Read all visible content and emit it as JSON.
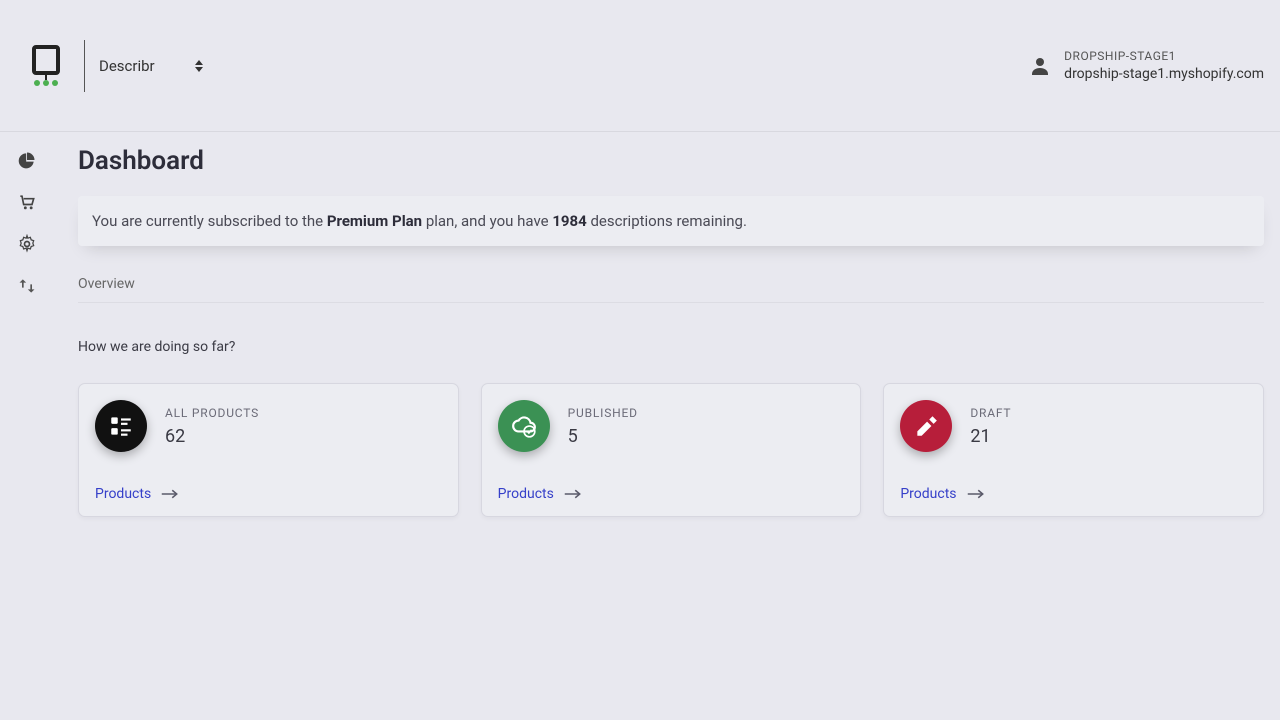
{
  "header": {
    "app_select_label": "Describr",
    "account": {
      "name": "DROPSHIP-STAGE1",
      "domain": "dropship-stage1.myshopify.com"
    }
  },
  "sidebar": {
    "items": [
      {
        "icon": "pie-chart-icon"
      },
      {
        "icon": "cart-icon"
      },
      {
        "icon": "gear-icon"
      },
      {
        "icon": "swap-icon"
      }
    ]
  },
  "main": {
    "page_title": "Dashboard",
    "banner": {
      "pre": "You are currently subscribed to the ",
      "plan": "Premium Plan",
      "mid": " plan, and you have ",
      "count": "1984",
      "post": " descriptions remaining."
    },
    "section_label": "Overview",
    "sub_label": "How we are doing so far?",
    "cards": [
      {
        "title": "ALL PRODUCTS",
        "value": "62",
        "link": "Products",
        "color": "black",
        "icon": "list-icon"
      },
      {
        "title": "PUBLISHED",
        "value": "5",
        "link": "Products",
        "color": "green",
        "icon": "cloud-check-icon"
      },
      {
        "title": "DRAFT",
        "value": "21",
        "link": "Products",
        "color": "red",
        "icon": "edit-icon"
      }
    ]
  }
}
